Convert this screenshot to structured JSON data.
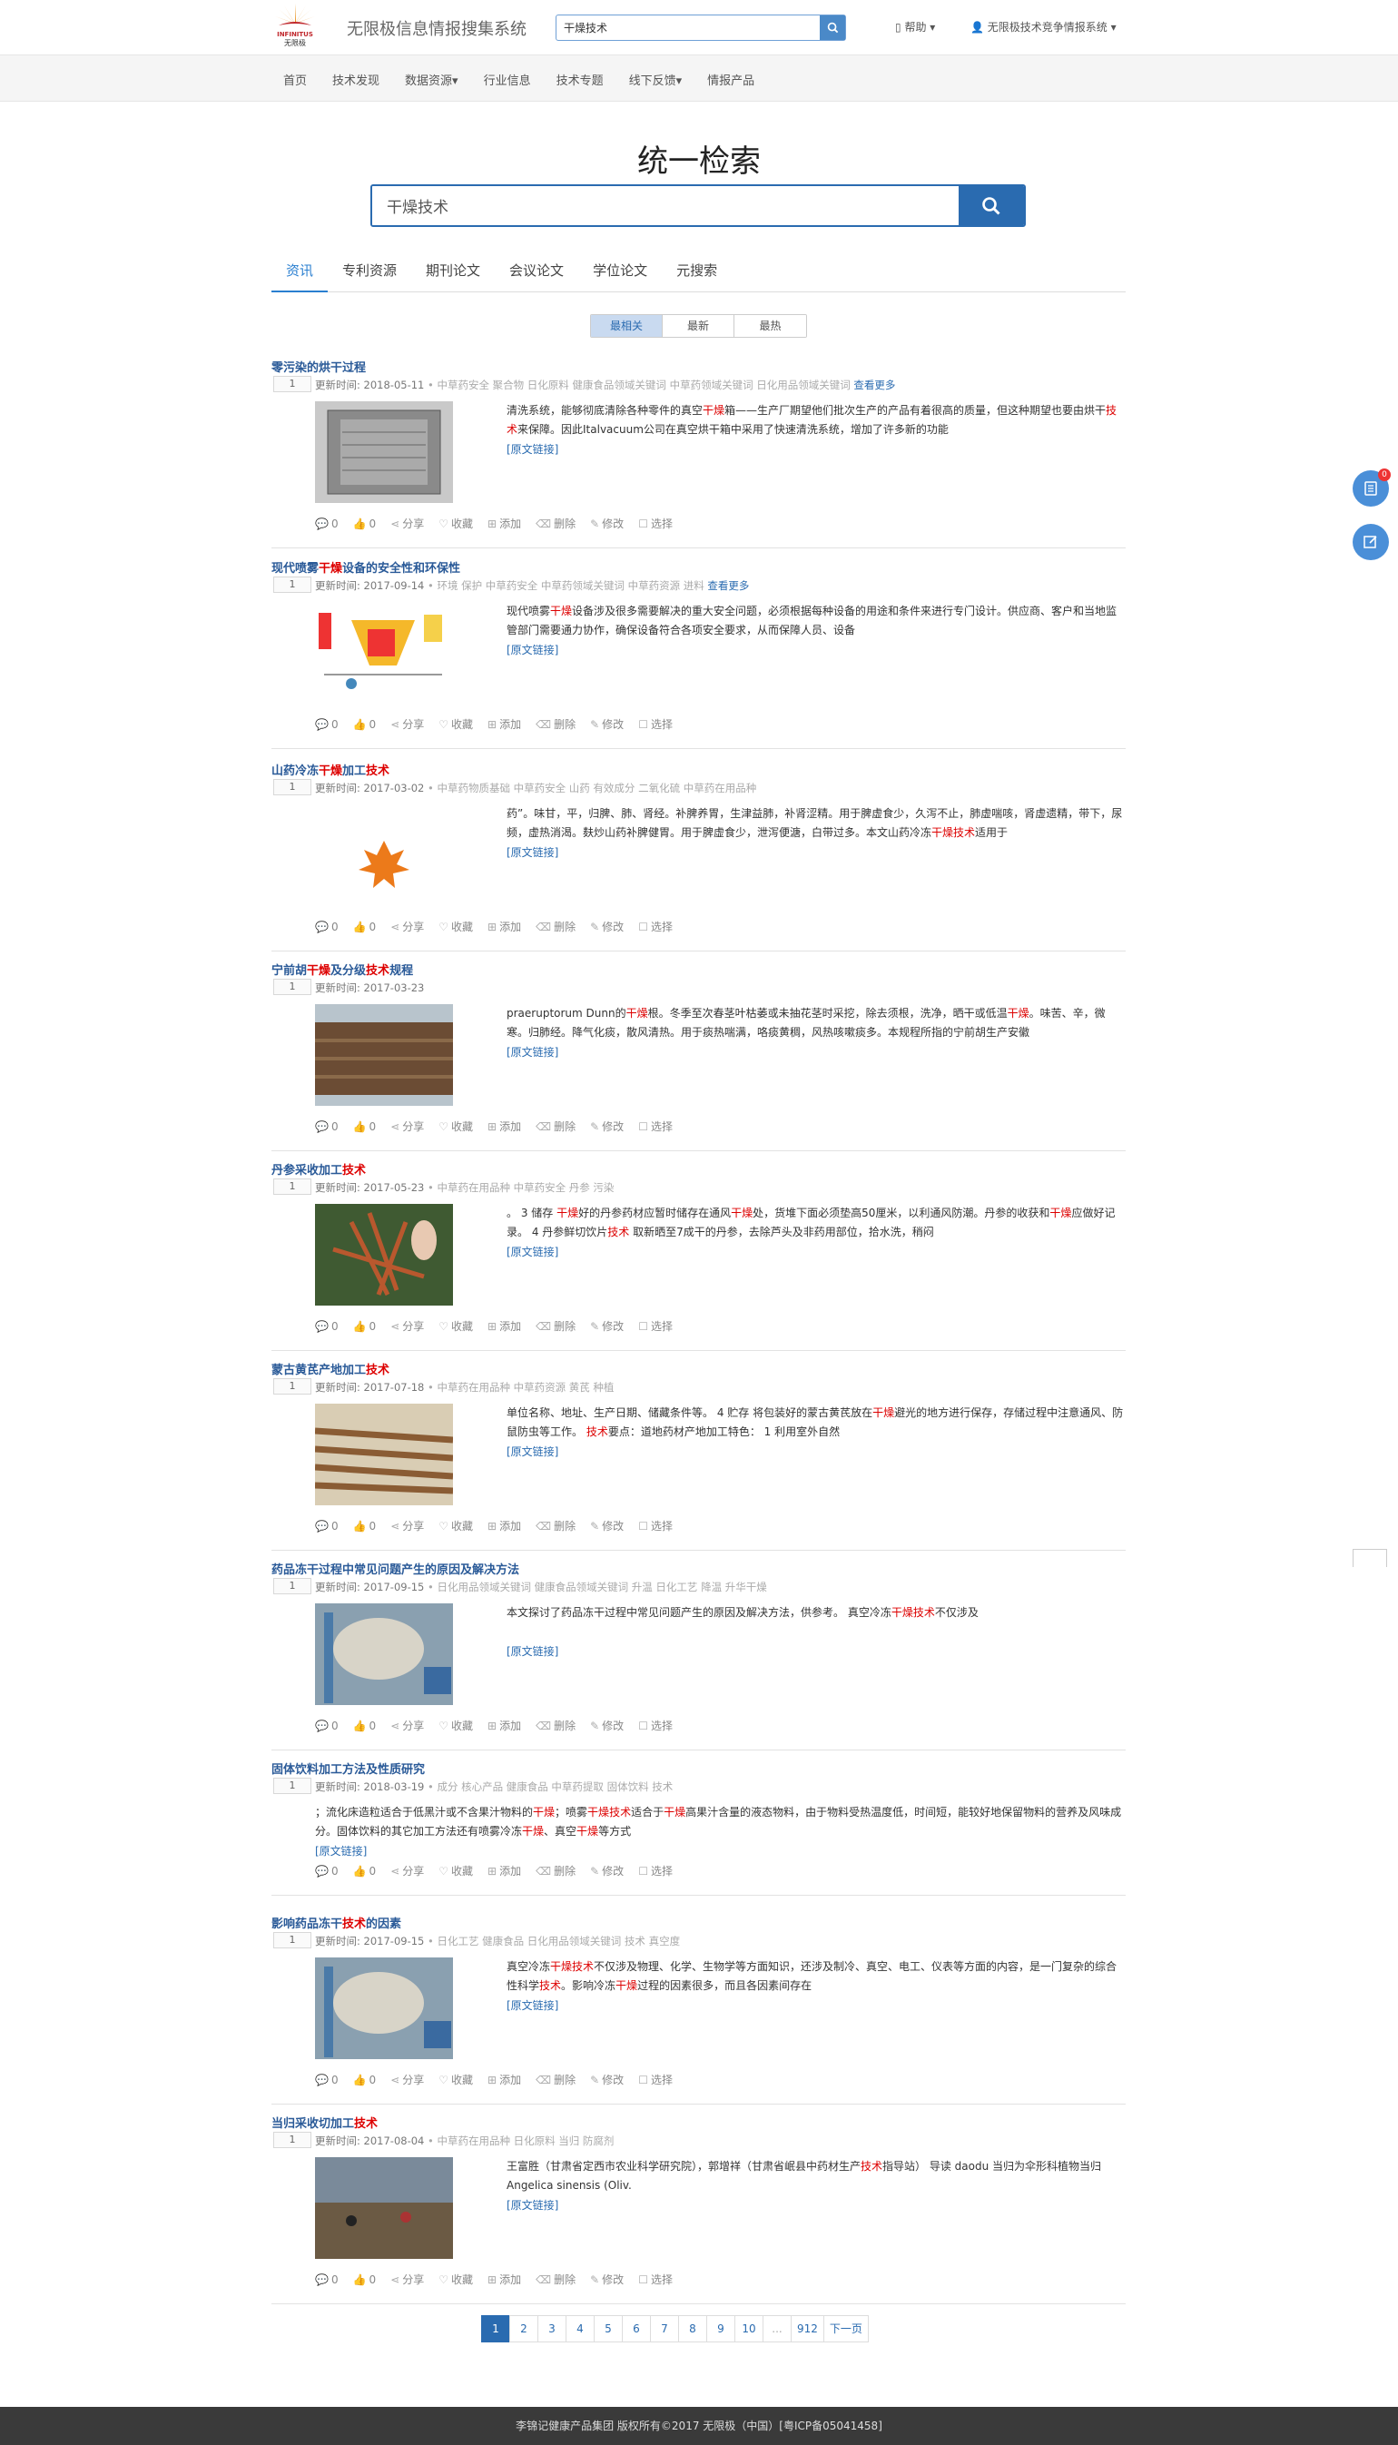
{
  "header": {
    "logo_line1": "INFINITUS",
    "logo_line2": "无限极",
    "system_title": "无限极信息情报搜集系统",
    "search_value": "干燥技术",
    "help_label": "帮助",
    "user_label": "无限极技术竞争情报系统"
  },
  "nav": [
    "首页",
    "技术发现",
    "数据资源",
    "行业信息",
    "技术专题",
    "线下反馈",
    "情报产品"
  ],
  "main": {
    "title": "统一检索",
    "search_value": "干燥技术"
  },
  "tabs": [
    "资讯",
    "专利资源",
    "期刊论文",
    "会议论文",
    "学位论文",
    "元搜索"
  ],
  "sort": [
    "最相关",
    "最新",
    "最热"
  ],
  "actions": {
    "comment": "0",
    "like": "0",
    "share": "分享",
    "favorite": "收藏",
    "add": "添加",
    "delete": "删除",
    "edit": "修改",
    "select": "选择"
  },
  "labels": {
    "updated": "更新时间:",
    "more": "查看更多",
    "source_link": "[原文链接]"
  },
  "results": [
    {
      "title": "零污染的烘干过程",
      "date": "2018-05-11",
      "tags": "中草药安全   聚合物   日化原料   健康食品领域关键词   中草药领域关键词   日化用品领域关键词",
      "more": true,
      "text": "清洗系统，能够彻底清除各种零件的真空干燥箱——生产厂期望他们批次生产的产品有着很高的质量，但这种期望也要由烘干技术来保障。因此Italvacuum公司在真空烘干箱中采用了快速清洗系统，增加了许多新的功能"
    },
    {
      "title": "现代喷雾干燥设备的安全性和环保性",
      "date": "2017-09-14",
      "tags": "环境   保护   中草药安全   中草药领域关键词   中草药资源   进料",
      "more": true,
      "text": "现代喷雾干燥设备涉及很多需要解决的重大安全问题，必须根据每种设备的用途和条件来进行专门设计。供应商、客户和当地监管部门需要通力协作，确保设备符合各项安全要求，从而保障人员、设备"
    },
    {
      "title": "山药冷冻干燥加工技术",
      "date": "2017-03-02",
      "tags": "中草药物质基础   中草药安全   山药   有效成分   二氧化硫   中草药在用品种",
      "more": false,
      "text": "药”。味甘，平，归脾、肺、肾经。补脾养胃，生津益肺，补肾涩精。用于脾虚食少，久泻不止，肺虚喘咳，肾虚遗精，带下，尿频，虚热消渴。麸炒山药补脾健胃。用于脾虚食少，泄泻便溏，白带过多。本文山药冷冻干燥技术适用于"
    },
    {
      "title": "宁前胡干燥及分级技术规程",
      "date": "2017-03-23",
      "tags": "",
      "more": false,
      "text": " praeruptorum Dunn的干燥根。冬季至次春茎叶枯萎或未抽花茎时采挖，除去须根，洗净，晒干或低温干燥。味苦、辛，微寒。归肺经。降气化痰，散风清热。用于痰热喘满，咯痰黄稠，风热咳嗽痰多。本规程所指的宁前胡生产安徽"
    },
    {
      "title": "丹参采收加工技术",
      "date": "2017-05-23",
      "tags": "中草药在用品种   中草药安全   丹参   污染",
      "more": false,
      "text": "。 3  储存 干燥好的丹参药材应暂时储存在通风干燥处，货堆下面必须垫高50厘米，以利通风防潮。丹参的收获和干燥应做好记录。 4  丹参鲜切饮片技术 取新晒至7成干的丹参，去除芦头及非药用部位，拾水洗，稍闷"
    },
    {
      "title": "蒙古黄芪产地加工技术",
      "date": "2017-07-18",
      "tags": "中草药在用品种   中草药资源   黄芪   种植",
      "more": false,
      "text": "单位名称、地址、生产日期、储藏条件等。 4  贮存 将包装好的蒙古黄芪放在干燥避光的地方进行保存，存储过程中注意通风、防鼠防虫等工作。 技术要点：道地药材产地加工特色： 1 利用室外自然"
    },
    {
      "title": "药品冻干过程中常见问题产生的原因及解决方法",
      "date": "2017-09-15",
      "tags": "日化用品领域关键词   健康食品领域关键词   升温   日化工艺   降温   升华干燥",
      "more": false,
      "text": "本文探讨了药品冻干过程中常见问题产生的原因及解决方法，供参考。 真空冷冻干燥技术不仅涉及"
    },
    {
      "title": "固体饮料加工方法及性质研究",
      "date": "2018-03-19",
      "tags": "成分   核心产品   健康食品   中草药提取   固体饮料   技术",
      "more": false,
      "text": "；流化床造粒适合于低黑汁或不含果汁物料的干燥；喷雾干燥技术适合于干燥高果汁含量的液态物料，由于物料受热温度低，时间短，能较好地保留物料的营养及风味成分。固体饮料的其它加工方法还有喷雾冷冻干燥、真空干燥等方式"
    },
    {
      "title": "影响药品冻干技术的因素",
      "date": "2017-09-15",
      "tags": "日化工艺   健康食品   日化用品领域关键词   技术   真空度",
      "more": false,
      "text": "真空冷冻干燥技术不仅涉及物理、化学、生物学等方面知识，还涉及制冷、真空、电工、仪表等方面的内容，是一门复杂的综合性科学技术。影响冷冻干燥过程的因素很多，而且各因素间存在"
    },
    {
      "title": "当归采收切加工技术",
      "date": "2017-08-04",
      "tags": "中草药在用品种   日化原料   当归   防腐剂",
      "more": false,
      "text": "王富胜（甘肃省定西市农业科学研究院），郭增祥（甘肃省岷县中药材生产技术指导站） 导读 daodu 当归为伞形科植物当归Angelica sinensis (Oliv."
    }
  ],
  "pagination": [
    "1",
    "2",
    "3",
    "4",
    "5",
    "6",
    "7",
    "8",
    "9",
    "10",
    "...",
    "912",
    "下一页"
  ],
  "float": {
    "badge": "0"
  },
  "footer": "李锦记健康产品集团    版权所有©2017 无限极（中国）[粤ICP备05041458]"
}
